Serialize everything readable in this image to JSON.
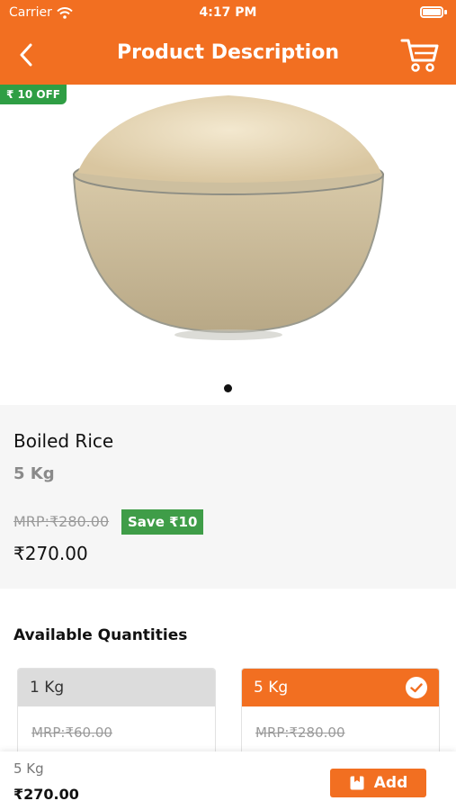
{
  "status_bar": {
    "carrier": "Carrier",
    "time": "4:17 PM"
  },
  "header": {
    "title": "Product Description"
  },
  "offer_badge": "₹ 10 OFF",
  "product": {
    "name": "Boiled Rice",
    "weight": "5 Kg",
    "mrp": "MRP:₹280.00",
    "save": "Save ₹10",
    "price": "₹270.00"
  },
  "quantities": {
    "title": "Available Quantities",
    "options": [
      {
        "label": "1 Kg",
        "mrp": "MRP:₹60.00",
        "selected": false
      },
      {
        "label": "5 Kg",
        "mrp": "MRP:₹280.00",
        "selected": true
      }
    ]
  },
  "bottom_bar": {
    "weight": "5 Kg",
    "price": "₹270.00",
    "add_label": "Add"
  },
  "colors": {
    "accent": "#f26f21",
    "save_green": "#3f9d48",
    "badge_green": "#2f9e44"
  }
}
